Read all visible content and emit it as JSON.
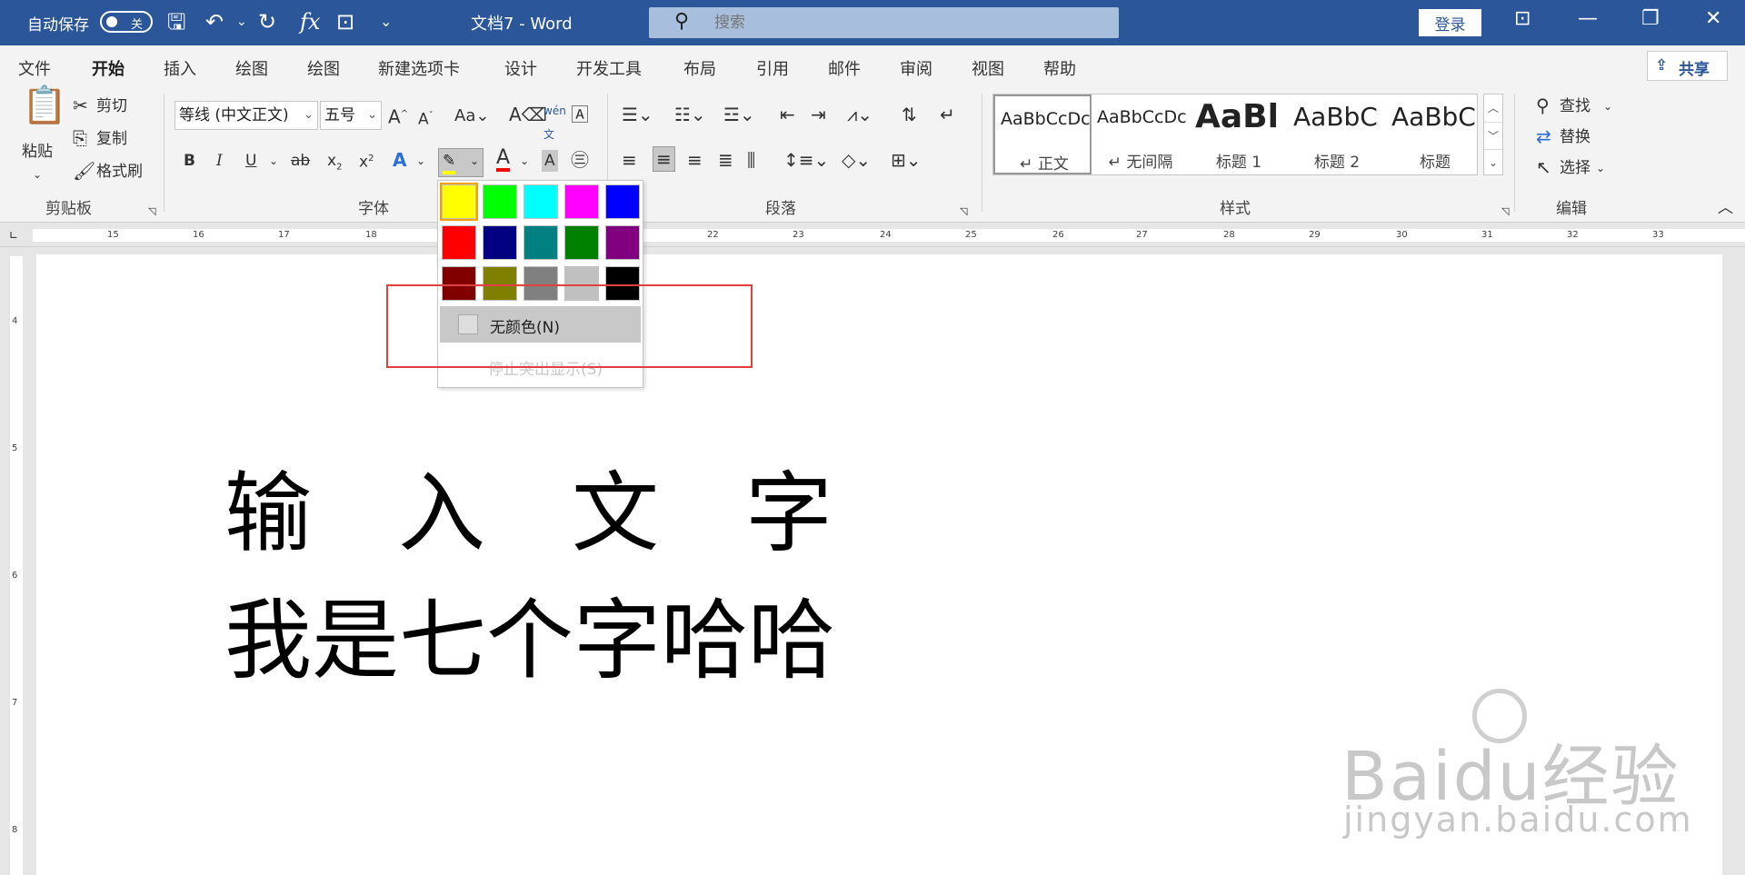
{
  "titlebar": {
    "autosave_label": "自动保存",
    "autosave_state": "关",
    "doc_title": "文档7  -  Word",
    "search_placeholder": "搜索",
    "login_label": "登录",
    "icons": [
      "save-icon",
      "undo-icon",
      "redo-icon",
      "function-icon",
      "touch-mode-icon",
      "customize-icon"
    ]
  },
  "tabs": [
    "文件",
    "开始",
    "插入",
    "绘图",
    "绘图",
    "新建选项卡",
    "设计",
    "开发工具",
    "布局",
    "引用",
    "邮件",
    "审阅",
    "视图",
    "帮助"
  ],
  "active_tab": "开始",
  "share_label": "共享",
  "ribbon": {
    "clipboard": {
      "paste": "粘贴",
      "cut": "剪切",
      "copy": "复制",
      "format_painter": "格式刷",
      "group": "剪贴板"
    },
    "font": {
      "font_name": "等线 (中文正文)",
      "font_size": "五号",
      "group": "字体"
    },
    "paragraph": {
      "group": "段落"
    },
    "styles": {
      "group": "样式",
      "items": [
        {
          "sample": "AaBbCcDc",
          "name": "↵ 正文"
        },
        {
          "sample": "AaBbCcDc",
          "name": "↵ 无间隔"
        },
        {
          "sample": "AaBl",
          "name": "标题 1"
        },
        {
          "sample": "AaBbC",
          "name": "标题 2"
        },
        {
          "sample": "AaBbC",
          "name": "标题"
        }
      ]
    },
    "editing": {
      "find": "查找",
      "replace": "替换",
      "select": "选择",
      "group": "编辑"
    }
  },
  "ruler_numbers": [
    "15",
    "16",
    "17",
    "18",
    "22",
    "23",
    "24",
    "25",
    "26",
    "27",
    "28",
    "29",
    "30",
    "31",
    "32",
    "33"
  ],
  "vruler_numbers": [
    "4",
    "5",
    "6",
    "7",
    "8"
  ],
  "highlight_menu": {
    "colors": [
      "#ffff00",
      "#00ff00",
      "#00ffff",
      "#ff00ff",
      "#0000ff",
      "#ff0000",
      "#000080",
      "#008080",
      "#008000",
      "#800080",
      "#800000",
      "#808000",
      "#808080",
      "#c0c0c0",
      "#000000"
    ],
    "no_color": "无颜色(N)",
    "stop_highlight": "停止突出显示(S)"
  },
  "document": {
    "line1": "输入文字",
    "line2": "我是七个字哈哈"
  },
  "watermark": {
    "brand": "Baidu经验",
    "url": "jingyan.baidu.com"
  }
}
